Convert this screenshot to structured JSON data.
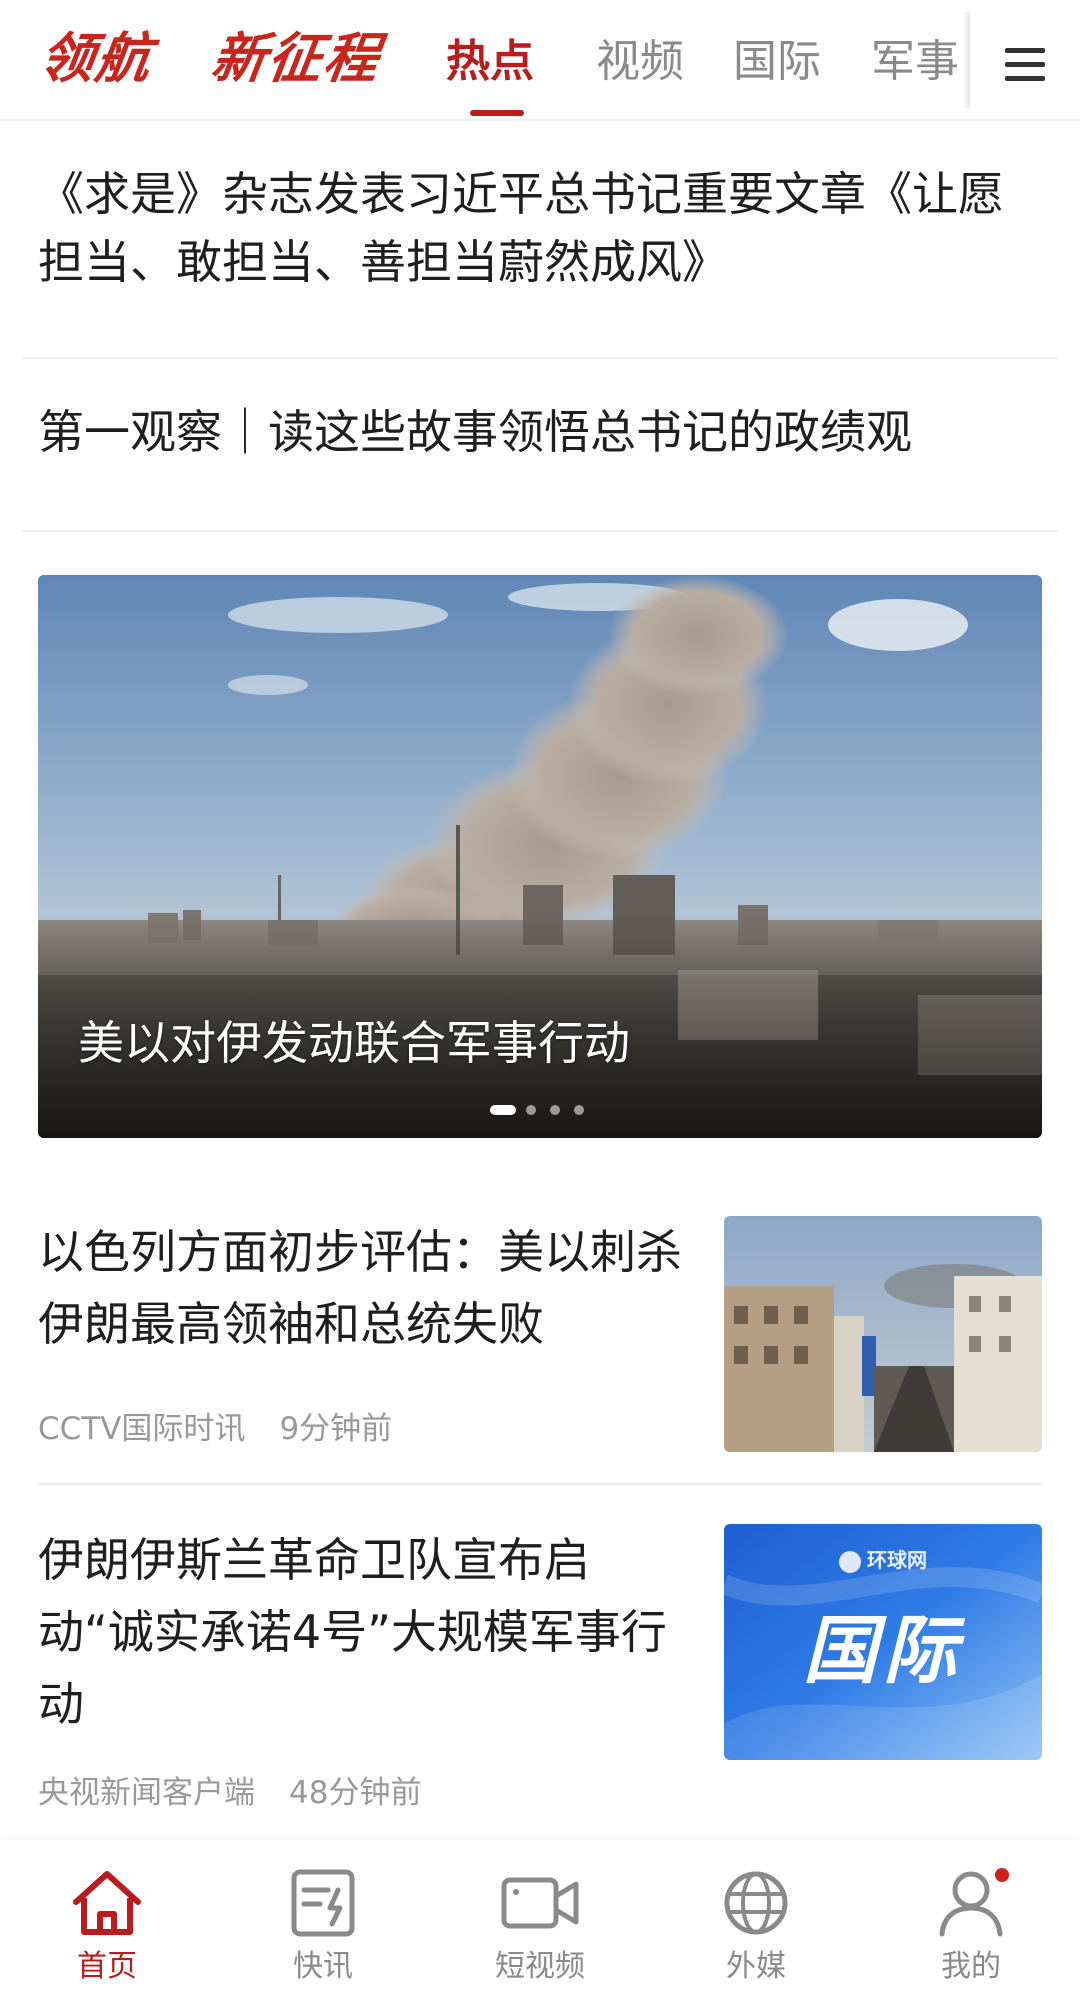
{
  "colors": {
    "accent": "#b81c1c",
    "brand": "#c8251d",
    "inactive_text": "#8a8a8a",
    "meta_text": "#999999"
  },
  "header": {
    "brand_1": "领航",
    "brand_2": "新征程",
    "tabs": [
      {
        "label": "热点",
        "active": true
      },
      {
        "label": "视频",
        "active": false
      },
      {
        "label": "国际",
        "active": false
      },
      {
        "label": "军事",
        "active": false
      }
    ],
    "menu_icon": "hamburger-menu-icon"
  },
  "headlines": [
    {
      "text": "《求是》杂志发表习近平总书记重要文章《让愿担当、敢担当、善担当蔚然成风》"
    },
    {
      "text": "第一观察｜读这些故事领悟总书记的政绩观"
    }
  ],
  "carousel": {
    "caption": "美以对伊发动联合军事行动",
    "slide_count": 4,
    "active_slide": 1
  },
  "news": [
    {
      "title": "以色列方面初步评估：美以刺杀伊朗最高领袖和总统失败",
      "source": "CCTV国际时讯",
      "time": "9分钟前"
    },
    {
      "title": "伊朗伊斯兰革命卫队宣布启动“诚实承诺4号”大规模军事行动",
      "source": "央视新闻客户端",
      "time": "48分钟前",
      "thumb_text": "国际",
      "thumb_logo": "环球网"
    }
  ],
  "bottom_nav": [
    {
      "label": "首页",
      "icon": "home-icon",
      "active": true
    },
    {
      "label": "快讯",
      "icon": "flash-news-icon",
      "active": false
    },
    {
      "label": "短视频",
      "icon": "video-camera-icon",
      "active": false
    },
    {
      "label": "外媒",
      "icon": "globe-icon",
      "active": false
    },
    {
      "label": "我的",
      "icon": "user-icon",
      "active": false,
      "badge": true
    }
  ]
}
